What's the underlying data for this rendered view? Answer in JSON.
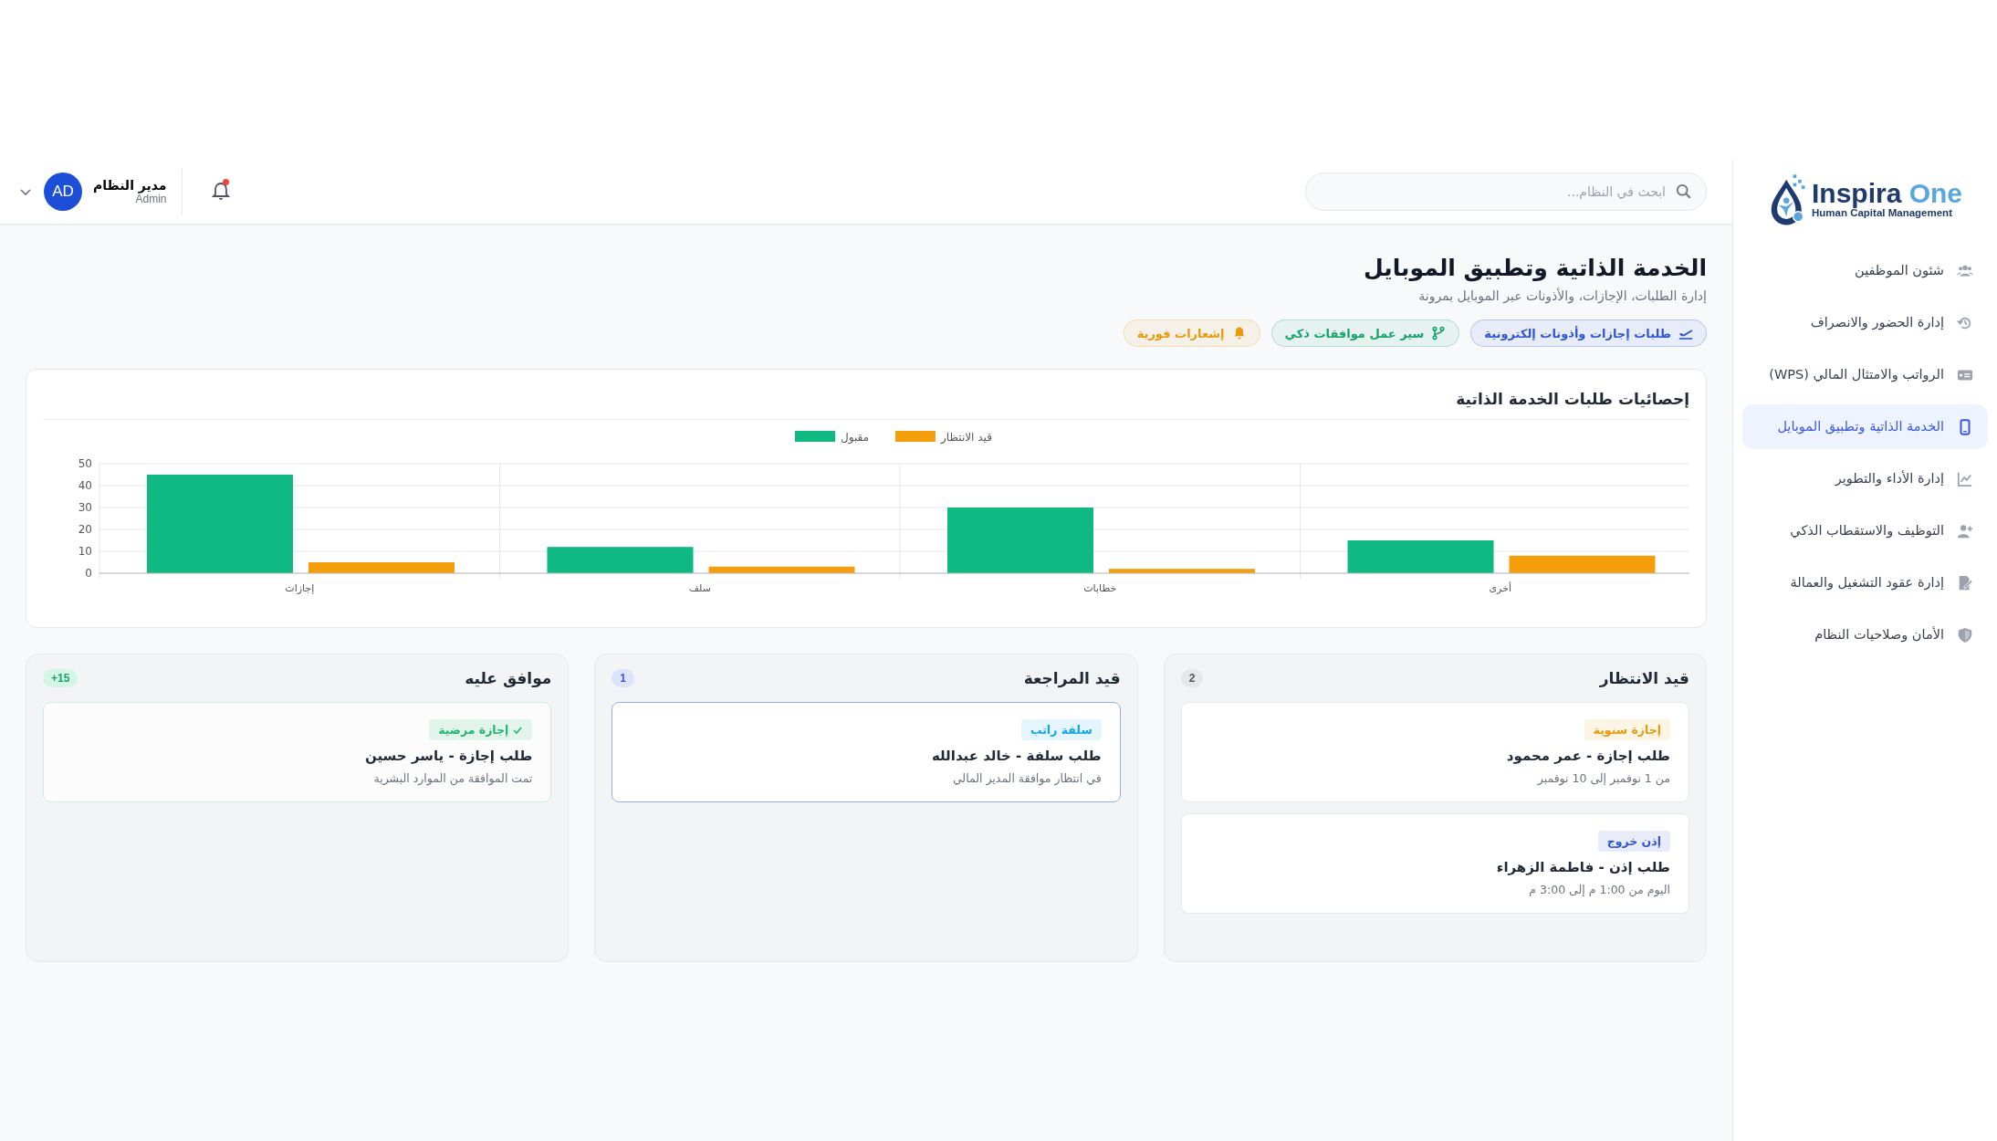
{
  "brand": {
    "name_main": "Inspira",
    "name_accent": "One",
    "tagline": "Human Capital Management"
  },
  "sidebar": {
    "items": [
      {
        "label": "شئون الموظفين",
        "kind": "users",
        "selected": false
      },
      {
        "label": "إدارة الحضور والانصراف",
        "kind": "history",
        "selected": false
      },
      {
        "label": "الرواتب والامتثال المالي (WPS)",
        "kind": "money",
        "selected": false
      },
      {
        "label": "الخدمة الذاتية وتطبيق الموبايل",
        "kind": "mobile",
        "selected": true
      },
      {
        "label": "إدارة الأداء والتطوير",
        "kind": "chart",
        "selected": false
      },
      {
        "label": "التوظيف والاستقطاب الذكي",
        "kind": "user-plus",
        "selected": false
      },
      {
        "label": "إدارة عقود التشغيل والعمالة",
        "kind": "contract",
        "selected": false
      },
      {
        "label": "الأمان وصلاحيات النظام",
        "kind": "shield",
        "selected": false
      }
    ]
  },
  "header": {
    "search": {
      "placeholder": "ابحث في النظام..."
    },
    "notifications": {
      "unread": true
    },
    "user": {
      "name": "مدير النظام",
      "role": "Admin",
      "initials": "AD"
    }
  },
  "page": {
    "title": "الخدمة الذاتية وتطبيق الموبايل",
    "subtitle": "إدارة الطلبات، الإجازات، والأذونات عبر الموبايل بمرونة",
    "features": [
      {
        "label": "طلبات إجازات وأذونات إلكترونية",
        "kind": "plane",
        "color": "#2f55d4"
      },
      {
        "label": "سير عمل موافقات ذكي",
        "kind": "branch",
        "color": "#16a36a"
      },
      {
        "label": "إشعارات فورية",
        "kind": "bell",
        "color": "#e89a0c"
      }
    ]
  },
  "stats": {
    "title": "إحصائيات طلبات الخدمة الذاتية",
    "chart_data": {
      "type": "bar",
      "categories": [
        "إجازات",
        "سلف",
        "خطابات",
        "أخرى"
      ],
      "series": [
        {
          "name": "مقبول",
          "color": "#10b981",
          "values": [
            45,
            12,
            30,
            15
          ]
        },
        {
          "name": "قيد الانتظار",
          "color": "#f59e0b",
          "values": [
            5,
            3,
            2,
            8
          ]
        }
      ],
      "ylim": [
        0,
        50
      ],
      "yticks": [
        0,
        10,
        20,
        30,
        40,
        50
      ],
      "grid": true,
      "legend": true
    }
  },
  "board": {
    "columns": [
      {
        "title": "قيد الانتظار",
        "count": "2",
        "kind": "pending",
        "cards": [
          {
            "tag": "إجازة سنوية",
            "color": "#e89a0c",
            "title": "طلب إجازة - عمر محمود",
            "detail": "من 1 نوفمبر إلى 10 نوفمبر",
            "selected": false
          },
          {
            "tag": "إذن خروج",
            "color": "#2f55d4",
            "title": "طلب إذن - فاطمة الزهراء",
            "detail": "اليوم من 1:00 م إلى 3:00 م",
            "selected": false
          }
        ]
      },
      {
        "title": "قيد المراجعة",
        "count": "1",
        "kind": "review",
        "cards": [
          {
            "tag": "سلفة راتب",
            "color": "#0ea5e9",
            "title": "طلب سلفة - خالد عبدالله",
            "detail": "في انتظار موافقة المدير المالي",
            "selected": true
          }
        ]
      },
      {
        "title": "موافق عليه",
        "count": "+15",
        "kind": "approved",
        "cards": [
          {
            "tag": "إجازة مرضية",
            "color": "#22b573",
            "title": "طلب إجازة - ياسر حسين",
            "detail": "تمت الموافقة من الموارد البشرية",
            "selected": false
          }
        ]
      }
    ]
  }
}
